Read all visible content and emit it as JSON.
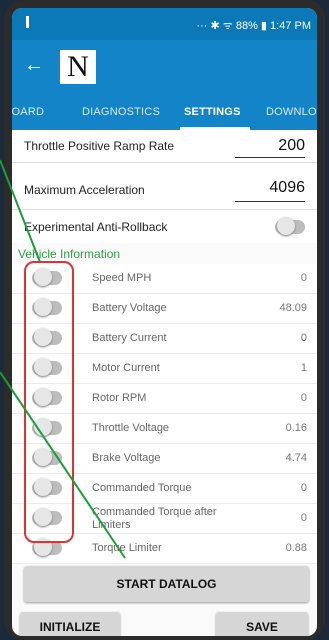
{
  "status_bar": {
    "text": "··· ✱ ᯤ 88% ▮ 1:47 PM"
  },
  "app": {
    "back_glyph": "←",
    "logo_text": "N"
  },
  "tabs": [
    "BOARD",
    "DIAGNOSTICS",
    "SETTINGS",
    "DOWNLOAD"
  ],
  "active_tab": "SETTINGS",
  "settings": {
    "throttle_ramp": {
      "label": "Throttle Positive Ramp Rate",
      "value": "200"
    },
    "max_accel": {
      "label": "Maximum Acceleration",
      "value": "4096"
    },
    "anti_rollback": {
      "label": "Experimental Anti-Rollback"
    }
  },
  "vehicle": {
    "header": "Vehicle Information",
    "items": [
      {
        "label": "Speed MPH",
        "value": "0"
      },
      {
        "label": "Battery Voltage",
        "value": "48.09"
      },
      {
        "label": "Battery Current",
        "value": "0"
      },
      {
        "label": "Motor Current",
        "value": "1"
      },
      {
        "label": "Rotor RPM",
        "value": "0"
      },
      {
        "label": "Throttle Voltage",
        "value": "0.16"
      },
      {
        "label": "Brake Voltage",
        "value": "4.74"
      },
      {
        "label": "Commanded Torque",
        "value": "0"
      },
      {
        "label": "Commanded Torque after Limiters",
        "value": "0"
      },
      {
        "label": "Torque Limiter",
        "value": "0.88"
      }
    ]
  },
  "buttons": {
    "start_datalog": "START DATALOG",
    "initialize": "INITIALIZE",
    "save": "SAVE"
  },
  "colors": {
    "accent": "#1484c8",
    "section": "#2f9e44",
    "annotation_box": "#d33333",
    "annotation_arrow": "#1a9e3a"
  }
}
